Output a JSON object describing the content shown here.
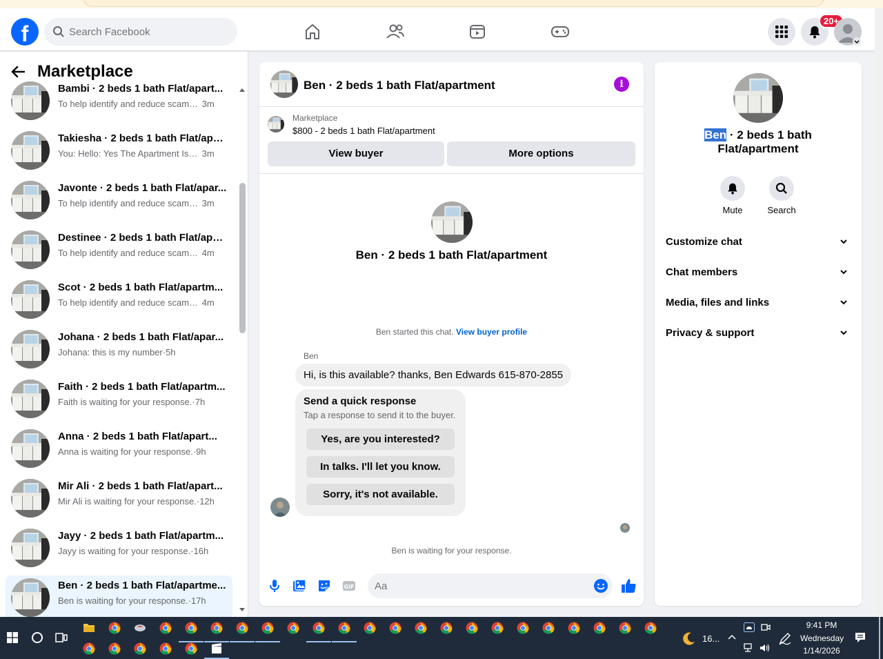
{
  "top_nav": {
    "search_placeholder": "Search Facebook",
    "notification_badge": "20+",
    "icons": [
      "home-icon",
      "friends-icon",
      "watch-icon",
      "gaming-icon",
      "menu-grid-icon",
      "bell-icon",
      "profile-avatar"
    ]
  },
  "sidebar": {
    "title": "Marketplace",
    "chats": [
      {
        "name": "Bambi · 2 beds 1 bath Flat/apart...",
        "preview": "To help identify and reduce scams ...",
        "time": "3m",
        "sep": " ",
        "active": false
      },
      {
        "name": "Takiesha · 2 beds 1 bath Flat/apa...",
        "preview": "You: Hello: Yes The Apartment Is St...",
        "time": "3m",
        "sep": " ",
        "active": false
      },
      {
        "name": "Javonte · 2 beds 1 bath Flat/apar...",
        "preview": "To help identify and reduce scams ...",
        "time": "3m",
        "sep": " ",
        "active": false
      },
      {
        "name": "Destinee · 2 beds 1 bath Flat/apa...",
        "preview": "To help identify and reduce scams ...",
        "time": "4m",
        "sep": " ",
        "active": false
      },
      {
        "name": "Scot · 2 beds 1 bath Flat/apartm...",
        "preview": "To help identify and reduce scams ...",
        "time": "4m",
        "sep": " ",
        "active": false
      },
      {
        "name": "Johana · 2 beds 1 bath Flat/apar...",
        "preview": "Johana: this is my number",
        "time": "5h",
        "sep": "·",
        "active": false
      },
      {
        "name": "Faith · 2 beds 1 bath Flat/apartm...",
        "preview": "Faith is waiting for your response.",
        "time": "7h",
        "sep": "·",
        "active": false
      },
      {
        "name": "Anna · 2 beds 1 bath Flat/apart...",
        "preview": "Anna is waiting for your response.",
        "time": "9h",
        "sep": "·",
        "active": false
      },
      {
        "name": "Mir Ali · 2 beds 1 bath Flat/apart...",
        "preview": "Mir Ali is waiting for your response.",
        "time": "12h",
        "sep": "·",
        "active": false
      },
      {
        "name": "Jayy · 2 beds 1 bath Flat/apartm...",
        "preview": "Jayy is waiting for your response.",
        "time": "16h",
        "sep": "·",
        "active": false
      },
      {
        "name": "Ben · 2 beds 1 bath Flat/apartme...",
        "preview": "Ben is waiting for your response.",
        "time": "17h",
        "sep": "·",
        "active": true
      }
    ]
  },
  "chat": {
    "header_title": "Ben · 2 beds 1 bath Flat/apartment",
    "marketplace_label": "Marketplace",
    "listing": "$800 - 2 beds 1 bath Flat/apartment",
    "view_buyer": "View buyer",
    "more_options": "More options",
    "intro_title": "Ben · 2 beds 1 bath Flat/apartment",
    "started_text": "Ben started this chat.",
    "view_profile_link": "View buyer profile",
    "sender": "Ben",
    "message": "Hi, is this available? thanks, Ben Edwards  615-870-2855",
    "quick_title": "Send a quick response",
    "quick_sub": "Tap a response to send it to the buyer.",
    "quick_replies": [
      "Yes, are you interested?",
      "In talks. I'll let you know.",
      "Sorry, it's not available."
    ],
    "waiting_text": "Ben is waiting for your response.",
    "input_placeholder": "Aa"
  },
  "details": {
    "title_highlight": "Ben",
    "title_rest": " · 2 beds 1 bath Flat/apartment",
    "actions": [
      {
        "label": "Mute",
        "icon": "bell-icon"
      },
      {
        "label": "Search",
        "icon": "search-icon"
      }
    ],
    "sections": [
      "Customize chat",
      "Chat members",
      "Media, files and links",
      "Privacy & support"
    ]
  },
  "taskbar": {
    "weather": "16...",
    "time": "9:41 PM",
    "day": "Wednesday",
    "date": "1/14/2026"
  },
  "colors": {
    "brand_blue": "#0866ff",
    "active_bg": "#ebf5ff",
    "info_purple": "#a50fd8",
    "taskbar": "#1f2b3a"
  }
}
